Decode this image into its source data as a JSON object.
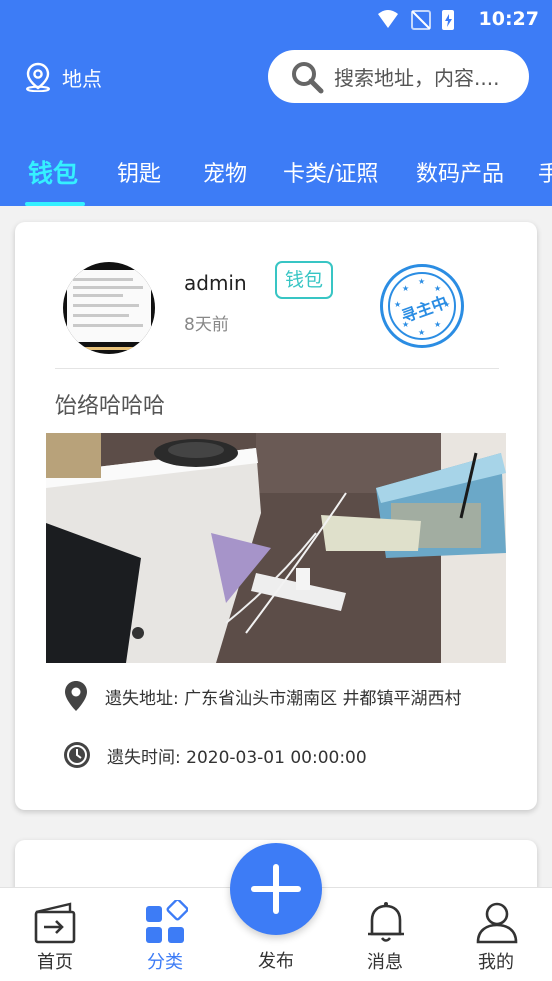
{
  "status_bar": {
    "time": "10:27"
  },
  "header": {
    "location_label": "地点",
    "search_placeholder": "搜索地址，内容...."
  },
  "tabs": [
    "钱包",
    "钥匙",
    "宠物",
    "卡类/证照",
    "数码产品",
    "手"
  ],
  "active_tab": 0,
  "posts": [
    {
      "username": "admin",
      "time_ago": "8天前",
      "category": "钱包",
      "stamp_text": "寻主中",
      "title": "饴络哈哈哈",
      "address_label": "遗失地址: 广东省汕头市潮南区 井都镇平湖西村",
      "time_label": "遗失时间: 2020-03-01 00:00:00"
    }
  ],
  "bottom_nav": {
    "home": "首页",
    "category": "分类",
    "publish": "发布",
    "messages": "消息",
    "mine": "我的"
  },
  "colors": {
    "primary": "#3d7cf6",
    "active_tab": "#35f0ff",
    "badge": "#38c5c4",
    "stamp": "#2b8de3"
  }
}
